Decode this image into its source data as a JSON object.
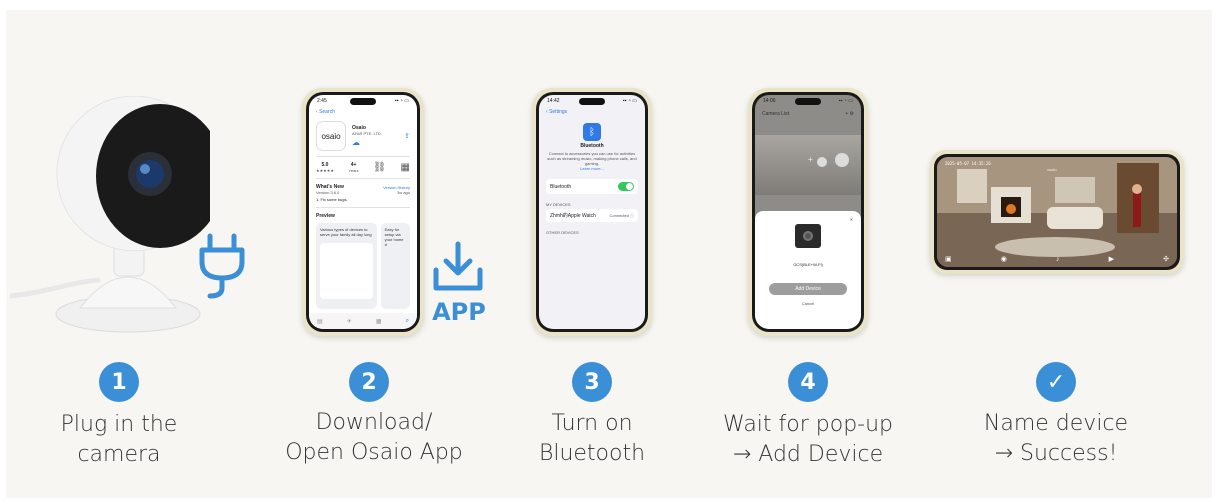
{
  "steps": [
    {
      "number": "1",
      "caption_line1": "Plug in the",
      "caption_line2": "camera"
    },
    {
      "number": "2",
      "caption_line1": "Download/",
      "caption_line2": "Open Osaio App"
    },
    {
      "number": "3",
      "caption_line1": "Turn on",
      "caption_line2": "Bluetooth"
    },
    {
      "number": "4",
      "caption_line1": "Wait for pop-up",
      "caption_line2": "→ Add Device"
    },
    {
      "number": "✓",
      "caption_line1": "Name device",
      "caption_line2": "→ Success!"
    }
  ],
  "app_badge": {
    "label": "APP",
    "icon": "download-icon"
  },
  "plug_icon": "plug-icon",
  "colors": {
    "accent": "#3b8fd6",
    "background": "#f8f6f2",
    "phone_frame": "#e9e4c8",
    "toggle_on": "#34c759"
  },
  "app_store_screen": {
    "time": "2:45",
    "back_label": "Search",
    "app_name": "Osaio",
    "logo_text": "osaio",
    "developer": "AFAR PTE. LTD.",
    "rating": "5.0",
    "age": "4+",
    "whats_new_title": "What's New",
    "version_history": "Version History",
    "version": "Version 3.6.0",
    "version_ago": "3w ago",
    "fix_note": "1. Fix some bugs.",
    "preview_title": "Preview",
    "preview_text_1": "Various types of devices to serve your family all day long",
    "preview_text_2": "Easy for setup via your home d"
  },
  "bluetooth_screen": {
    "time": "14:42",
    "back_label": "Settings",
    "title": "Bluetooth",
    "description": "Connect to accessories you can use for activities such as streaming music, making phone calls, and gaming.",
    "learn_more": "Learn more...",
    "toggle_label": "Bluetooth",
    "my_devices": "MY DEVICES",
    "device_name": "Zhmh的Apple Watch",
    "device_status": "Connected",
    "other_devices": "OTHER DEVICES"
  },
  "camera_list_screen": {
    "time": "14:06",
    "title": "Camera List",
    "device_id": "GCS(BLE+W-Fi)",
    "add_button": "Add Device",
    "cancel": "Cancel"
  },
  "live_view": {
    "timestamp": "2025-05-07 14:35:26",
    "watermark": "osaio"
  }
}
